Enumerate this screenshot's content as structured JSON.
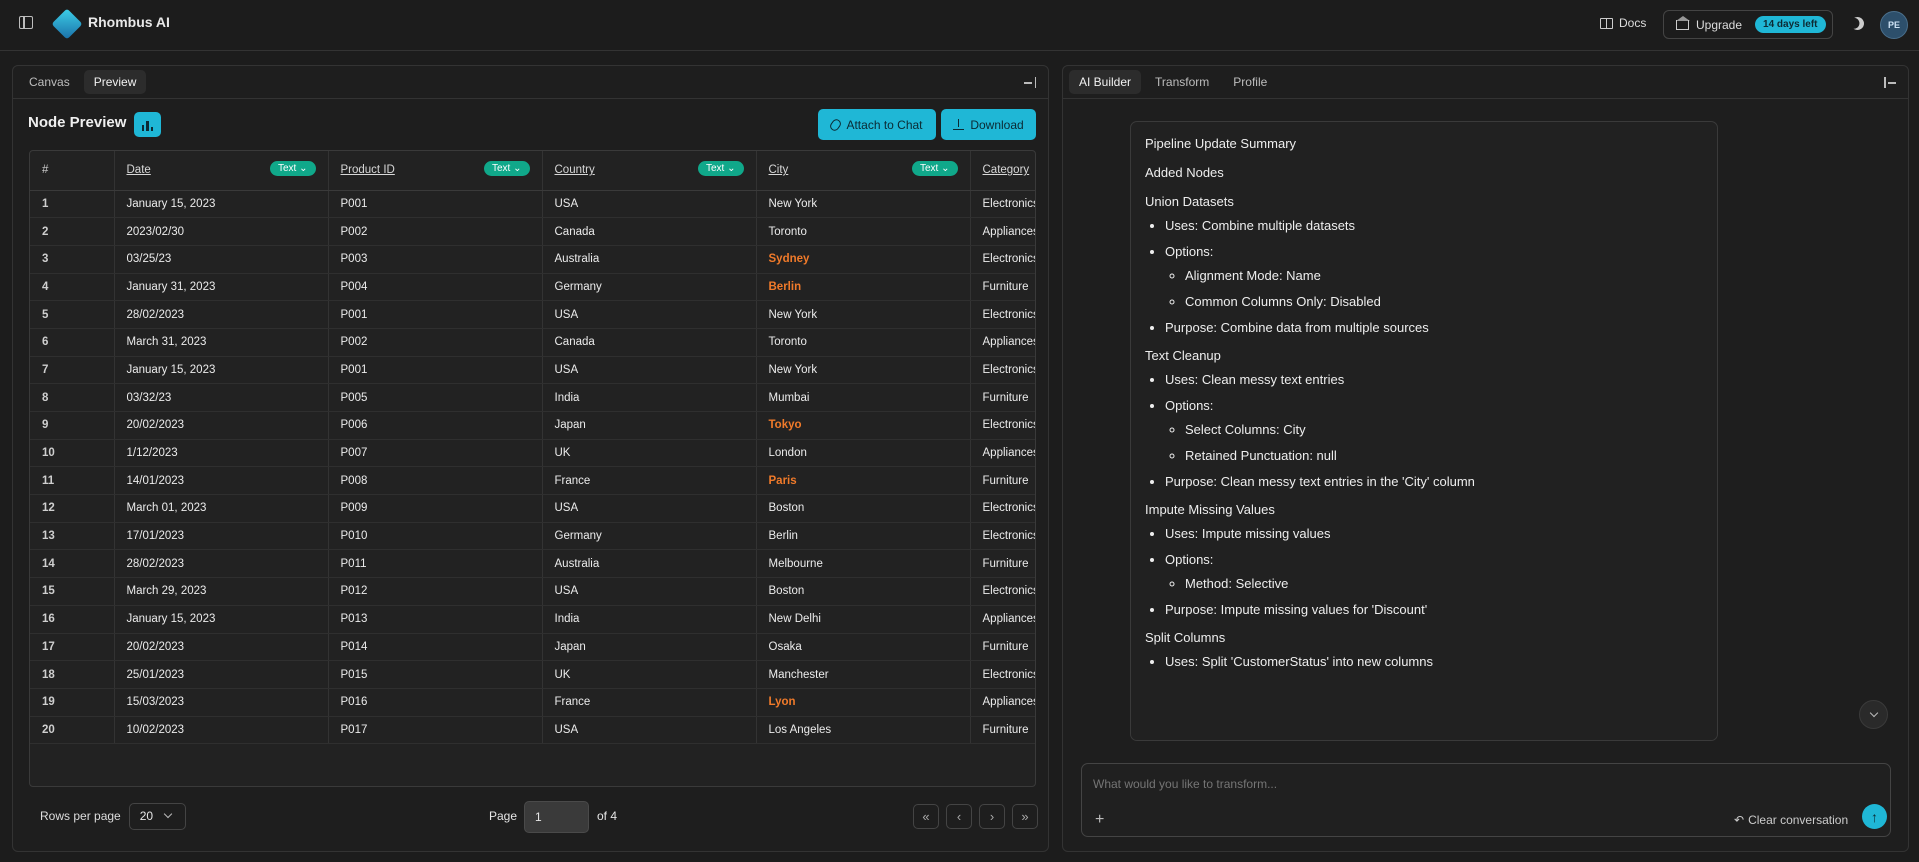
{
  "app": {
    "name": "Rhombus AI"
  },
  "header": {
    "docs_label": "Docs",
    "upgrade_label": "Upgrade",
    "trial_badge": "14 days left",
    "avatar_initials": "PE"
  },
  "left_panel": {
    "tabs": [
      "Canvas",
      "Preview"
    ],
    "active_tab": "Preview",
    "title": "Node Preview",
    "attach_label": "Attach to Chat",
    "download_label": "Download",
    "columns": [
      {
        "name": "#",
        "type": ""
      },
      {
        "name": "Date",
        "type": "Text"
      },
      {
        "name": "Product ID",
        "type": "Text"
      },
      {
        "name": "Country",
        "type": "Text"
      },
      {
        "name": "City",
        "type": "Text"
      },
      {
        "name": "Category",
        "type": ""
      }
    ],
    "rows": [
      [
        "1",
        "January 15, 2023",
        "P001",
        "USA",
        "New York",
        "Electronics"
      ],
      [
        "2",
        "2023/02/30",
        "P002",
        "Canada",
        "Toronto",
        "Appliances"
      ],
      [
        "3",
        "03/25/23",
        "P003",
        "Australia",
        "Sydney",
        "Electronics"
      ],
      [
        "4",
        "January 31, 2023",
        "P004",
        "Germany",
        "Berlin",
        "Furniture"
      ],
      [
        "5",
        "28/02/2023",
        "P001",
        "USA",
        "New York",
        "Electronics"
      ],
      [
        "6",
        "March 31, 2023",
        "P002",
        "Canada",
        "Toronto",
        "Appliances"
      ],
      [
        "7",
        "January 15, 2023",
        "P001",
        "USA",
        "New York",
        "Electronics"
      ],
      [
        "8",
        "03/32/23",
        "P005",
        "India",
        "Mumbai",
        "Furniture"
      ],
      [
        "9",
        "20/02/2023",
        "P006",
        "Japan",
        "Tokyo",
        "Electronics"
      ],
      [
        "10",
        "1/12/2023",
        "P007",
        "UK",
        "London",
        "Appliances"
      ],
      [
        "11",
        "14/01/2023",
        "P008",
        "France",
        "Paris",
        "Furniture"
      ],
      [
        "12",
        "March 01, 2023",
        "P009",
        "USA",
        "Boston",
        "Electronics"
      ],
      [
        "13",
        "17/01/2023",
        "P010",
        "Germany",
        "Berlin",
        "Electronics"
      ],
      [
        "14",
        "28/02/2023",
        "P011",
        "Australia",
        "Melbourne",
        "Furniture"
      ],
      [
        "15",
        "March 29, 2023",
        "P012",
        "USA",
        "Boston",
        "Electronics"
      ],
      [
        "16",
        "January 15, 2023",
        "P013",
        "India",
        "New Delhi",
        "Appliances"
      ],
      [
        "17",
        "20/02/2023",
        "P014",
        "Japan",
        "Osaka",
        "Furniture"
      ],
      [
        "18",
        "25/01/2023",
        "P015",
        "UK",
        "Manchester",
        "Electronics"
      ],
      [
        "19",
        "15/03/2023",
        "P016",
        "France",
        "Lyon",
        "Appliances"
      ],
      [
        "20",
        "10/02/2023",
        "P017",
        "USA",
        "Los Angeles",
        "Furniture"
      ]
    ],
    "highlighted_city_rows": [
      3,
      4,
      9,
      11,
      19
    ],
    "highlight_color": "#f07a2a",
    "pager": {
      "rows_per_page_label": "Rows per page",
      "rows_per_page": "20",
      "page_label": "Page",
      "page": "1",
      "of_label": "of 4"
    }
  },
  "right_panel": {
    "tabs": [
      "AI Builder",
      "Transform",
      "Profile"
    ],
    "active_tab": "AI Builder",
    "summary": {
      "heading": "Pipeline Update Summary",
      "subheading": "Added Nodes",
      "sections": [
        {
          "title": "Union Datasets",
          "uses_label": "Uses:",
          "uses": "Combine multiple datasets",
          "options_label": "Options:",
          "options": [
            "Alignment Mode: Name",
            "Common Columns Only: Disabled"
          ],
          "purpose_label": "Purpose:",
          "purpose": "Combine data from multiple sources"
        },
        {
          "title": "Text Cleanup",
          "uses_label": "Uses:",
          "uses": "Clean messy text entries",
          "options_label": "Options:",
          "options": [
            "Select Columns: City",
            "Retained Punctuation: null"
          ],
          "purpose_label": "Purpose:",
          "purpose": "Clean messy text entries in the 'City' column"
        },
        {
          "title": "Impute Missing Values",
          "uses_label": "Uses:",
          "uses": "Impute missing values",
          "options_label": "Options:",
          "options": [
            "Method: Selective"
          ],
          "purpose_label": "Purpose:",
          "purpose": "Impute missing values for 'Discount'"
        },
        {
          "title": "Split Columns",
          "uses_label": "Uses:",
          "uses": "Split 'CustomerStatus' into new columns"
        }
      ]
    },
    "composer": {
      "placeholder": "What would you like to transform...",
      "clear_label": "Clear conversation"
    }
  },
  "colors": {
    "accent": "#1fb7d6",
    "type_badge": "#10a88a",
    "background": "#1c1c1c"
  }
}
